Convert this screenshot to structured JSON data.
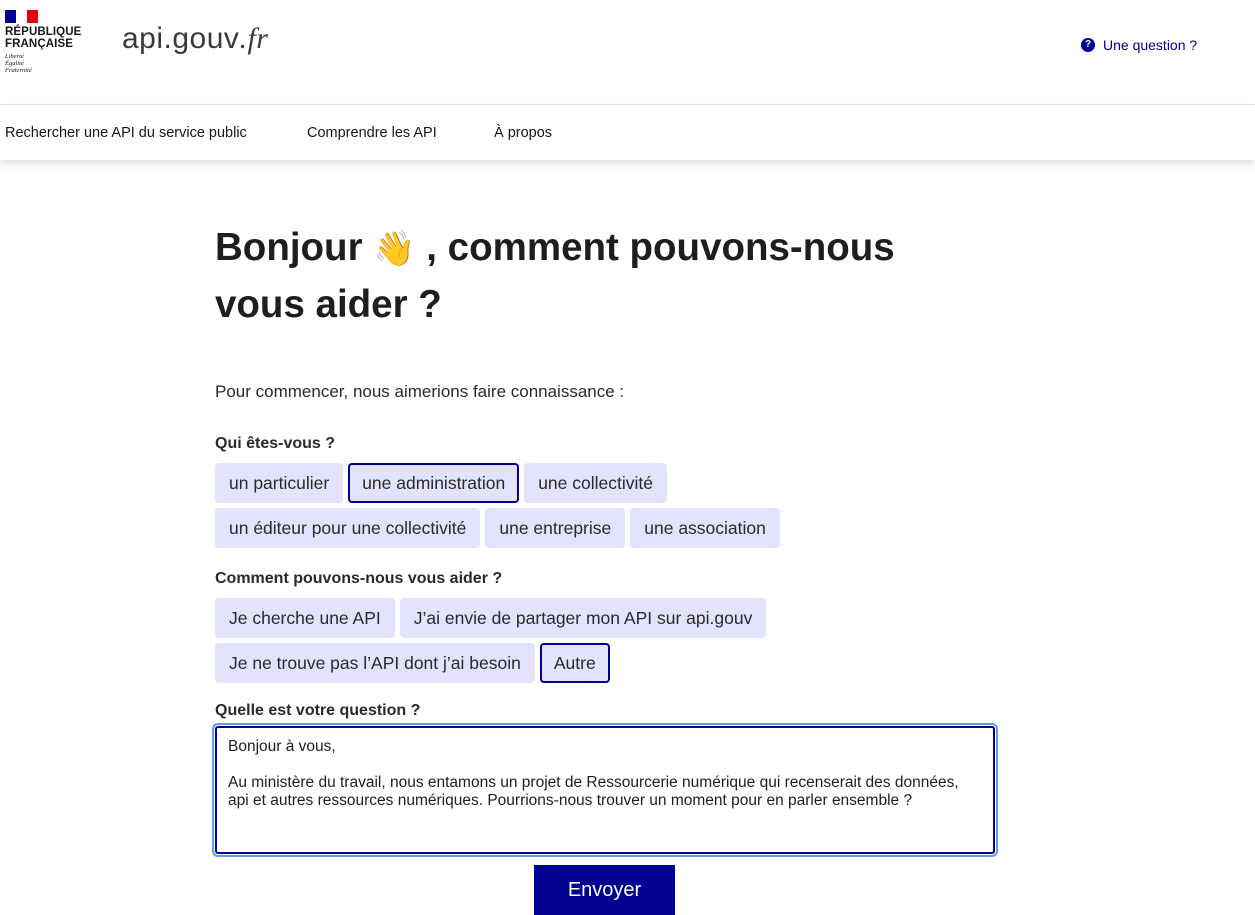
{
  "header": {
    "flag_colors": {
      "blue": "#000091",
      "white": "#ffffff",
      "red": "#e1000f"
    },
    "republique_line1": "RÉPUBLIQUE",
    "republique_line2": "FRANÇAISE",
    "devise": [
      "Liberté",
      "Égalité",
      "Fraternité"
    ],
    "site_name_main": "api.gouv",
    "site_name_suffix": ".fr",
    "help_icon": "question-circle-icon",
    "help_link": "Une question ?"
  },
  "nav": {
    "items": [
      {
        "label": "Rechercher une API du service public"
      },
      {
        "label": "Comprendre les API"
      },
      {
        "label": "À propos"
      }
    ]
  },
  "main": {
    "title_part1": "Bonjour ",
    "title_emoji": "👋",
    "title_part2": " , comment pouvons-nous vous aider ?",
    "intro": "Pour commencer, nous aimerions faire connaissance :",
    "who_label": "Qui êtes-vous ?",
    "who_options": [
      {
        "label": "un particulier",
        "selected": false
      },
      {
        "label": "une administration",
        "selected": true
      },
      {
        "label": "une collectivité",
        "selected": false
      },
      {
        "label": "un éditeur pour une collectivité",
        "selected": false
      },
      {
        "label": "une entreprise",
        "selected": false
      },
      {
        "label": "une association",
        "selected": false
      }
    ],
    "how_label": "Comment pouvons-nous vous aider ?",
    "how_options": [
      {
        "label": "Je cherche une API",
        "selected": false
      },
      {
        "label": "J’ai envie de partager mon API sur api.gouv",
        "selected": false
      },
      {
        "label": "Je ne trouve pas l’API dont j’ai besoin",
        "selected": false
      },
      {
        "label": "Autre",
        "selected": true
      }
    ],
    "question_label": "Quelle est votre question ?",
    "question_value": "Bonjour à vous,\n\nAu ministère du travail, nous entamons un projet de Ressourcerie numérique qui recenserait des données, api et autres ressources numériques. Pourrions-nous trouver un moment pour en parler ensemble ?",
    "submit_label": "Envoyer"
  },
  "colors": {
    "accent": "#000091",
    "tag_bg": "#e3e3fd",
    "focus_ring": "#5f9ce8"
  }
}
